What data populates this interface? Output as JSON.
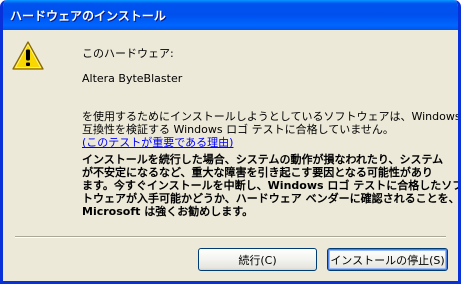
{
  "window": {
    "title": "ハードウェアのインストール"
  },
  "icons": {
    "warning": "warning-icon"
  },
  "message": {
    "device_heading": "このハードウェア:",
    "device_name": "Altera ByteBlaster",
    "para1_line1": "を使用するためにインストールしようとしているソフトウェアは、Windows XP との",
    "para1_line2": "互換性を検証する Windows ロゴ テストに合格していません。",
    "link_text": "(このテストが重要である理由)",
    "para2_line1": "インストールを続行した場合、システムの動作が損なわれたり、システム",
    "para2_line2": "が不安定になるなど、重大な障害を引き起こす要因となる可能性があり",
    "para2_line3": "ます。今すぐインストールを中断し、Windows ロゴ テストに合格したソフ",
    "para2_line4": "トウェアが入手可能かどうか、ハードウェア ベンダーに確認されることを、",
    "para2_line5": "Microsoft は強くお勧めします。"
  },
  "buttons": {
    "continue_label": "続行(C)",
    "stop_label": "インストールの停止(S)"
  },
  "colors": {
    "titlebar": "#0053EE",
    "dialog_bg": "#ECE9D8",
    "link": "#0000FF",
    "warning_fill": "#F8D800"
  }
}
